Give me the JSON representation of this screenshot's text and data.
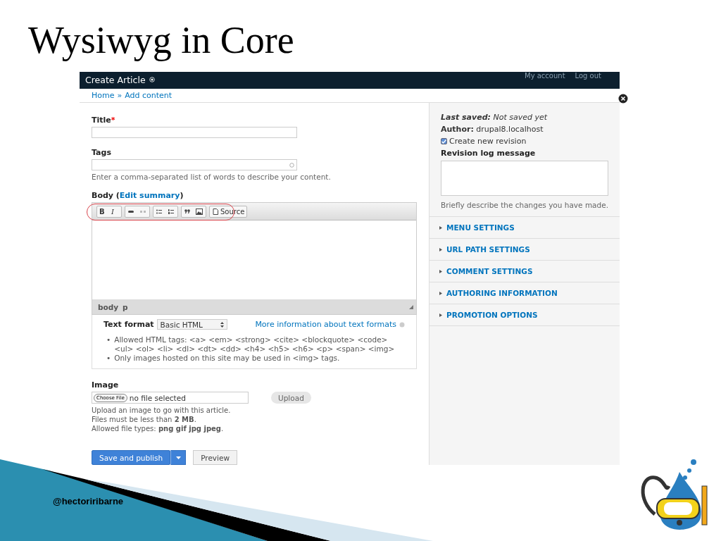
{
  "slide": {
    "title": "Wysiwyg in Core",
    "footer_handle": "@hectoriribarne"
  },
  "header": {
    "title": "Create Article",
    "links": [
      "My account",
      "Log out"
    ]
  },
  "breadcrumb": {
    "items": [
      "Home",
      "Add content"
    ],
    "separator": "»"
  },
  "form": {
    "title_field": {
      "label": "Title",
      "required_mark": "*"
    },
    "tags_field": {
      "label": "Tags",
      "hint": "Enter a comma-separated list of words to describe your content."
    },
    "body": {
      "label_before": "Body (",
      "link": "Edit summary",
      "label_after": ")",
      "toolbar": [
        [
          {
            "kind": "bold",
            "label": "B",
            "disabled": false
          },
          {
            "kind": "italic",
            "label": "I",
            "disabled": false
          }
        ],
        [
          {
            "kind": "link",
            "disabled": false
          },
          {
            "kind": "unlink",
            "disabled": true
          }
        ],
        [
          {
            "kind": "bulleted-list",
            "disabled": false
          },
          {
            "kind": "numbered-list",
            "disabled": false
          }
        ],
        [
          {
            "kind": "blockquote",
            "disabled": false
          },
          {
            "kind": "image",
            "disabled": false
          }
        ],
        [
          {
            "kind": "source",
            "label": "Source",
            "disabled": false
          }
        ]
      ],
      "path": [
        "body",
        "p"
      ],
      "text_format_label": "Text format",
      "text_format_value": "Basic HTML",
      "more_info_link": "More information about text formats",
      "tip_bullet": "•",
      "tips": [
        "Allowed HTML tags: <a> <em> <strong> <cite> <blockquote> <code> <ul> <ol> <li> <dl> <dt> <dd> <h4> <h5> <h6> <p> <span> <img>",
        "Only images hosted on this site may be used in <img> tags."
      ]
    },
    "image": {
      "label": "Image",
      "choose_button": "Choose File",
      "file_status": "no file selected",
      "upload_button": "Upload",
      "help": [
        "Upload an image to go with this article.",
        "Files must be less than **2 MB**.",
        "Allowed file types: **png gif jpg jpeg**."
      ]
    },
    "save_button": "Save and publish",
    "preview_button": "Preview"
  },
  "sidebar": {
    "last_saved": "**Last saved:** Not saved yet",
    "author": "**Author:** drupal8.localhost",
    "revision": {
      "label": "Create new revision",
      "checked": true
    },
    "log_label": "Revision log message",
    "log_hint": "Briefly describe the changes you have made.",
    "sections": [
      {
        "label": "MENU SETTINGS",
        "expanded": false
      },
      {
        "label": "URL PATH SETTINGS",
        "expanded": false
      },
      {
        "label": "COMMENT SETTINGS",
        "expanded": false
      },
      {
        "label": "AUTHORING INFORMATION",
        "expanded": false
      },
      {
        "label": "PROMOTION OPTIONS",
        "expanded": false
      }
    ]
  }
}
